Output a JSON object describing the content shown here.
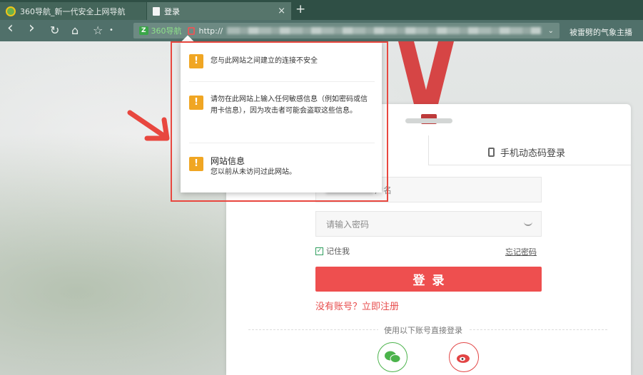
{
  "browser": {
    "tabs": [
      {
        "label": "360导航_新一代安全上网导航",
        "active": false
      },
      {
        "label": "登录",
        "active": true
      }
    ],
    "new_tab_symbol": "+",
    "tab_close_symbol": "×",
    "toolbar": {
      "back_icon": "‹",
      "forward_icon": "›",
      "reload_icon": "↻",
      "home_icon": "⌂",
      "star_icon": "☆",
      "star_menu_icon": "•",
      "badge": "Z",
      "nav_label": "360导航",
      "url_prefix": "http://",
      "dropdown_icon": "⌄",
      "trend_text": "被雷劈的气象主播"
    }
  },
  "security_popup": {
    "items": [
      {
        "icon": "!",
        "title": "",
        "text": "您与此网站之间建立的连接不安全"
      },
      {
        "icon": "!",
        "title": "",
        "text": "请勿在此网站上输入任何敏感信息（例如密码或信用卡信息），因为攻击者可能会盗取这些信息。"
      },
      {
        "icon": "!",
        "title": "网站信息",
        "text": "您以前从未访问过此网站。"
      }
    ]
  },
  "login": {
    "sms_tab_label": "手机动态码登录",
    "username_placeholder_suffix": "户名",
    "password_placeholder": "请输入密码",
    "remember_label": "记住我",
    "remember_checked": true,
    "forgot_label": "忘记密码",
    "login_button": "登录",
    "register_link": "没有账号？立即注册",
    "social_hint": "使用以下账号直接登录"
  },
  "colors": {
    "accent": "#ee4f4f",
    "warning": "#f0a623",
    "highlight_box": "#e8473f",
    "chrome": "#50706a"
  },
  "icons": [
    "back-icon",
    "forward-icon",
    "reload-icon",
    "home-icon",
    "star-icon",
    "lock-icon",
    "phone-icon",
    "eye-icon",
    "warning-icon",
    "wechat-icon",
    "weibo-icon"
  ]
}
